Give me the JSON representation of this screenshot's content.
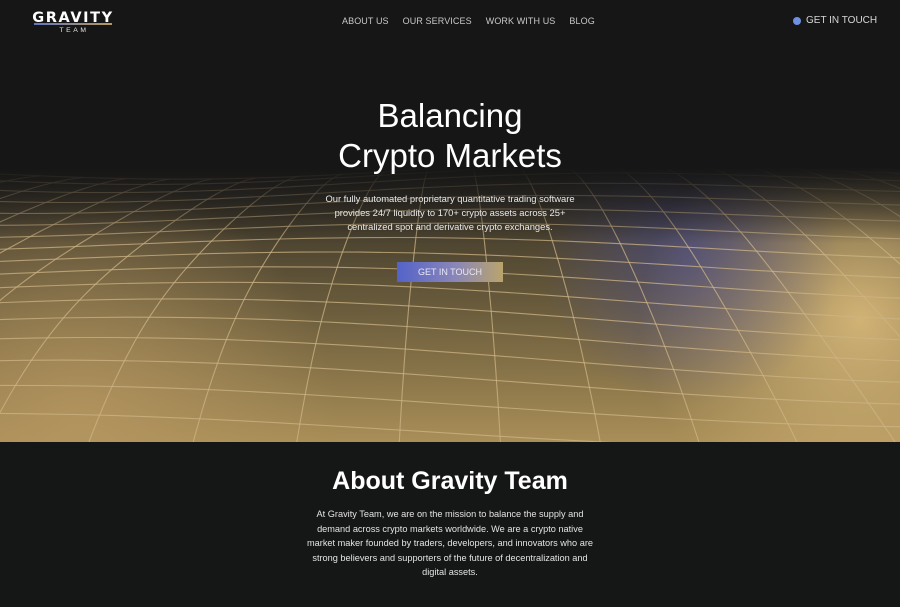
{
  "nav": {
    "logo_main": "GRAVITY",
    "logo_sub": "TEAM",
    "links": [
      "ABOUT US",
      "OUR SERVICES",
      "WORK WITH US",
      "BLOG"
    ],
    "cta_label": "GET IN TOUCH",
    "cta_dot_color": "#6f8fe0"
  },
  "hero": {
    "title_line1": "Balancing",
    "title_line2": "Crypto Markets",
    "subtitle": "Our fully automated proprietary quantitative trading software provides 24/7 liquidity to 170+ crypto assets across 25+ centralized spot and derivative crypto exchanges.",
    "button_label": "GET IN TOUCH"
  },
  "about": {
    "title": "About Gravity Team",
    "text": "At Gravity Team, we are on the mission to balance the supply and demand across crypto markets worldwide. We are a crypto native market maker founded by traders, developers, and innovators who are strong believers and supporters of the future of decentralization and digital assets."
  },
  "colors": {
    "background": "#151716",
    "accent_blue": "#5463c9",
    "accent_gold": "#c9a765"
  }
}
